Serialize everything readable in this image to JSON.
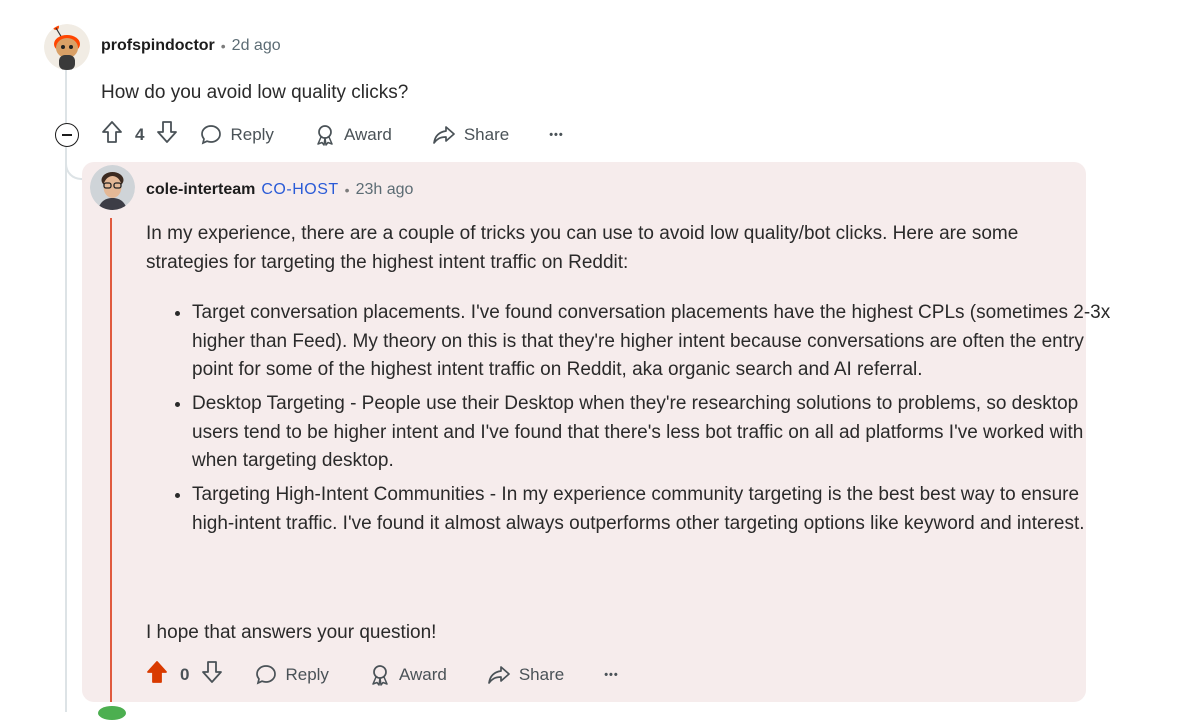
{
  "parent": {
    "author": "profspindoctor",
    "time": "2d ago",
    "body": "How do you avoid low quality clicks?",
    "votes": "4",
    "reply_label": "Reply",
    "award_label": "Award",
    "share_label": "Share",
    "more_label": "•••"
  },
  "reply": {
    "author": "cole-interteam",
    "flair": "CO-HOST",
    "time": "23h ago",
    "intro": "In my experience, there are a couple of tricks you can use to avoid low quality/bot clicks. Here are some strategies for targeting the highest intent traffic on Reddit:",
    "points": [
      "Target conversation placements. I've found conversation placements have the highest CPLs (sometimes 2-3x higher than Feed). My theory on this is that they're higher intent because conversations are often the entry point for some of the highest intent traffic on Reddit, aka organic search and AI referral.",
      "Desktop Targeting - People use their Desktop when they're researching solutions to problems, so desktop users tend to be higher intent and I've found that there's less bot traffic on all ad platforms I've worked with when targeting desktop.",
      "Targeting High-Intent Communities - In my experience community targeting is the best best way to ensure high-intent traffic. I've found it almost always outperforms other targeting options like keyword and interest."
    ],
    "closing": "I hope that answers your question!",
    "votes": "0",
    "upvoted": true,
    "reply_label": "Reply",
    "award_label": "Award",
    "share_label": "Share",
    "more_label": "•••"
  },
  "colors": {
    "upvote_active": "#d93a00",
    "flair": "#2a5bd7",
    "thread_highlight": "#e05a3e",
    "card_bg": "#f6ecec"
  }
}
